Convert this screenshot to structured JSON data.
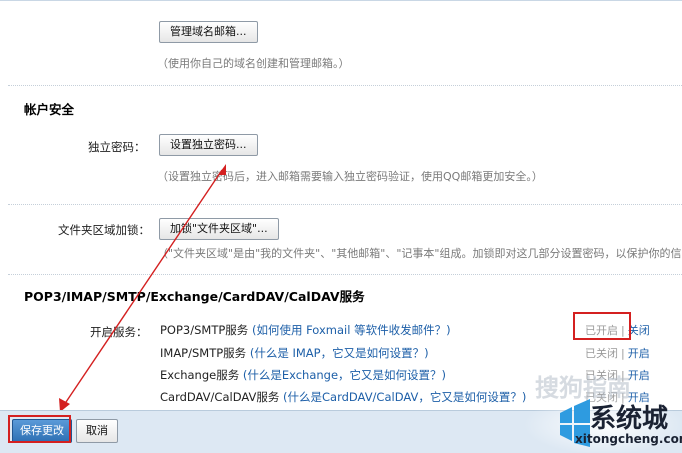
{
  "domain_section": {
    "manage_button": "管理域名邮箱...",
    "hint": "（使用你自己的域名创建和管理邮箱。）"
  },
  "account_security": {
    "title": "帐户安全",
    "password_label": "独立密码：",
    "password_button": "设置独立密码...",
    "password_hint": "（设置独立密码后，进入邮箱需要输入独立密码验证，使用QQ邮箱更加安全。）",
    "folder_label": "文件夹区域加锁：",
    "folder_button": "加锁\"文件夹区域\"...",
    "folder_hint": "（\"文件夹区域\"是由\"我的文件夹\"、\"其他邮箱\"、\"记事本\"组成。加锁即对这几部分设置密码，以保护你的信息。"
  },
  "services": {
    "title": "POP3/IMAP/SMTP/Exchange/CardDAV/CalDAV服务",
    "label": "开启服务：",
    "rows": [
      {
        "name": "POP3/SMTP服务",
        "link": "(如何使用 Foxmail 等软件收发邮件？)",
        "left_state": "已开启",
        "right_state": "关闭",
        "enabled": true
      },
      {
        "name": "IMAP/SMTP服务",
        "link": "(什么是 IMAP，它又是如何设置？)",
        "left_state": "已关闭",
        "right_state": "开启",
        "enabled": false
      },
      {
        "name": "Exchange服务",
        "link": "(什么是Exchange，它又是如何设置？)",
        "left_state": "已关闭",
        "right_state": "开启",
        "enabled": false
      },
      {
        "name": "CardDAV/CalDAV服务",
        "link": "(什么是CardDAV/CalDAV，它又是如何设置？)",
        "left_state": "已关闭",
        "right_state": "开启",
        "enabled": false
      }
    ]
  },
  "footer": {
    "save_label": "保存更改",
    "cancel_label": "取消"
  },
  "watermark": {
    "faint_text": "搜狗指南",
    "brand": "系统城",
    "url": "xitongcheng.com"
  },
  "colors": {
    "link": "#1d5fa8",
    "highlight": "#d42020",
    "footer_bg": "#dde8f3",
    "save_bg": "#2d6fb3"
  }
}
